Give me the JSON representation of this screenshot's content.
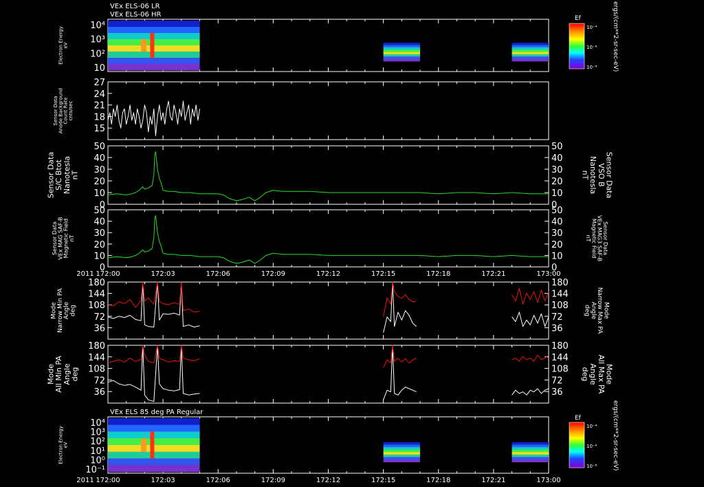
{
  "colors": {
    "green": "#22dd22",
    "red": "#ee1111",
    "white": "#ffffff"
  },
  "header": {
    "line1": "VEx ELS-06 LR",
    "line2": "VEx ELS-06 HR",
    "panel7_title": "VEx ELS 85 deg PA Regular"
  },
  "colorbar": {
    "title": "Ef",
    "unit": "ergs/(cm**2-sr-sec-eV)",
    "top_ticks": [
      "10⁻⁴",
      "10⁻⁶",
      "10⁻⁸"
    ],
    "bottom_ticks": [
      "10⁻⁴",
      "10⁻⁶",
      "10⁻⁸"
    ]
  },
  "time_axis": {
    "year": "2011",
    "ticks": [
      "172:00",
      "172:03",
      "172:06",
      "172:09",
      "172:12",
      "172:15",
      "172:18",
      "172:21",
      "173:00"
    ]
  },
  "chart_data": [
    {
      "type": "heatmap",
      "id": "p1",
      "ylabel": [
        "Electron Energy",
        "eV"
      ],
      "yticks": [
        "10⁴",
        "10³",
        "10²",
        "10"
      ],
      "segments": [
        {
          "start": "172:00",
          "end": "172:05"
        },
        {
          "start": "172:15",
          "end": "172:17"
        },
        {
          "start": "172:22",
          "end": "172:24"
        }
      ]
    },
    {
      "type": "line",
      "id": "p2",
      "ylabel": [
        "Sensor Data",
        "Anode Background",
        "Count Rate",
        "cnts/sec"
      ],
      "ylim": [
        12,
        27
      ],
      "yticks": [
        "27",
        "24",
        "21",
        "18",
        "15"
      ],
      "series": [
        {
          "color": "white",
          "x": [
            0,
            0.1,
            0.2,
            0.3,
            0.4,
            0.5,
            0.6,
            0.7,
            0.8,
            0.9,
            1.0,
            1.1,
            1.2,
            1.3,
            1.4,
            1.5,
            1.6,
            1.7,
            1.8,
            1.9,
            2.0,
            2.1,
            2.2,
            2.3,
            2.4,
            2.5,
            2.6,
            2.7,
            2.8,
            2.9,
            3.0,
            3.1,
            3.2,
            3.3,
            3.4,
            3.5,
            3.6,
            3.7,
            3.8,
            3.9,
            4.0,
            4.1,
            4.2,
            4.3,
            4.4,
            4.5,
            4.6,
            4.7,
            4.8,
            4.9,
            5.0
          ],
          "y": [
            17,
            19,
            16,
            20,
            18,
            21,
            17,
            15,
            19,
            20,
            16,
            18,
            21,
            17,
            19,
            16,
            20,
            18,
            15,
            17,
            21,
            19,
            14,
            18,
            16,
            20,
            13,
            18,
            21,
            17,
            19,
            16,
            20,
            22,
            18,
            17,
            21,
            19,
            16,
            20,
            18,
            22,
            17,
            19,
            21,
            16,
            20,
            18,
            21,
            17,
            20
          ]
        }
      ]
    },
    {
      "type": "line",
      "id": "p3",
      "ylabel": [
        "Sensor Data",
        "S/C Btot",
        "Nanotesla",
        "nT"
      ],
      "ylabel_right": [
        "Sensor Data",
        "VSO B",
        "Nanotesla",
        "nT"
      ],
      "ylim": [
        0,
        50
      ],
      "yticks": [
        "50",
        "40",
        "30",
        "20",
        "10",
        "0"
      ],
      "series": [
        {
          "color": "green",
          "x": [
            0,
            0.5,
            1.0,
            1.3,
            1.5,
            1.7,
            1.9,
            2.0,
            2.2,
            2.4,
            2.5,
            2.55,
            2.6,
            2.7,
            2.8,
            2.9,
            3.0,
            3.3,
            3.6,
            4.0,
            4.5,
            5.0,
            5.5,
            6.0,
            6.3,
            6.6,
            7.0,
            7.3,
            7.7,
            8.0,
            8.3,
            8.6,
            9.0,
            9.5,
            10,
            11,
            12,
            13,
            14,
            15,
            16,
            17,
            18,
            19,
            20,
            21,
            22,
            23,
            24
          ],
          "y": [
            8,
            9,
            8,
            9,
            10,
            12,
            15,
            13,
            14,
            16,
            25,
            42,
            45,
            30,
            22,
            18,
            12,
            11,
            11,
            10,
            10,
            9,
            9,
            9,
            8,
            5,
            3,
            4,
            6,
            3,
            6,
            10,
            12,
            11,
            11,
            11,
            10,
            10,
            10,
            10,
            10,
            10,
            9,
            10,
            10,
            9,
            10,
            9,
            9
          ]
        }
      ]
    },
    {
      "type": "line",
      "id": "p4",
      "ylabel": [
        "Sensor Data",
        "VEx MAG SAF-B",
        "Magnetic Field",
        "nT"
      ],
      "ylabel_right": [
        "Sensor Data",
        "VEx MAG3 SAF-B",
        "Magnetic Field",
        "nT"
      ],
      "ylim": [
        0,
        50
      ],
      "yticks": [
        "50",
        "40",
        "30",
        "20",
        "10",
        "0"
      ],
      "series": [
        {
          "color": "green",
          "x": [
            0,
            0.5,
            1.0,
            1.3,
            1.5,
            1.7,
            1.9,
            2.0,
            2.2,
            2.4,
            2.5,
            2.55,
            2.6,
            2.7,
            2.8,
            2.9,
            3.0,
            3.3,
            3.6,
            4.0,
            4.5,
            5.0,
            5.5,
            6.0,
            6.3,
            6.6,
            7.0,
            7.3,
            7.7,
            8.0,
            8.3,
            8.6,
            9.0,
            9.5,
            10,
            11,
            12,
            13,
            14,
            15,
            16,
            17,
            18,
            19,
            20,
            21,
            22,
            23,
            24
          ],
          "y": [
            8,
            9,
            8,
            9,
            10,
            12,
            15,
            13,
            14,
            16,
            25,
            42,
            45,
            30,
            22,
            18,
            12,
            11,
            11,
            10,
            10,
            9,
            9,
            9,
            8,
            5,
            3,
            4,
            6,
            3,
            6,
            10,
            12,
            11,
            11,
            11,
            10,
            10,
            10,
            10,
            10,
            10,
            9,
            10,
            10,
            9,
            10,
            9,
            9
          ]
        }
      ]
    },
    {
      "type": "line",
      "id": "p5",
      "ylabel": [
        "Mode",
        "Narrow Min PA",
        "Angle",
        "deg"
      ],
      "ylabel_right": [
        "Mode",
        "Narrow Max PA",
        "Angle",
        "deg"
      ],
      "ylim": [
        0,
        180
      ],
      "yticks": [
        "180",
        "144",
        "108",
        "72",
        "36"
      ],
      "series": [
        {
          "color": "white",
          "x": [
            0,
            0.3,
            0.6,
            0.9,
            1.2,
            1.5,
            1.8,
            1.9,
            2.0,
            2.2,
            2.5,
            2.7,
            2.8,
            3.0,
            3.3,
            3.6,
            3.9,
            4.0,
            4.1,
            4.4,
            4.7,
            5.0,
            null,
            15.0,
            15.2,
            15.4,
            15.5,
            15.6,
            15.8,
            16.0,
            16.2,
            16.4,
            16.6,
            16.8,
            null,
            22.0,
            22.2,
            22.4,
            22.6,
            22.8,
            23.0,
            23.2,
            23.4,
            23.6,
            23.8,
            24.0
          ],
          "y": [
            70,
            65,
            72,
            68,
            75,
            62,
            58,
            180,
            45,
            40,
            38,
            180,
            60,
            80,
            78,
            82,
            76,
            180,
            40,
            45,
            38,
            42,
            null,
            20,
            70,
            55,
            180,
            40,
            85,
            60,
            90,
            75,
            50,
            40,
            null,
            70,
            55,
            85,
            40,
            60,
            45,
            75,
            50,
            80,
            40,
            70
          ]
        },
        {
          "color": "red",
          "x": [
            0,
            0.3,
            0.6,
            0.9,
            1.2,
            1.5,
            1.8,
            1.9,
            2.0,
            2.2,
            2.5,
            2.7,
            2.8,
            3.0,
            3.3,
            3.6,
            3.9,
            4.0,
            4.1,
            4.4,
            4.7,
            5.0,
            null,
            15.0,
            15.2,
            15.4,
            15.5,
            15.6,
            15.8,
            16.0,
            16.2,
            16.4,
            16.6,
            16.8,
            null,
            22.0,
            22.2,
            22.4,
            22.6,
            22.8,
            23.0,
            23.2,
            23.4,
            23.6,
            23.8,
            24.0
          ],
          "y": [
            110,
            105,
            118,
            112,
            125,
            100,
            122,
            180,
            120,
            130,
            110,
            180,
            118,
            112,
            108,
            115,
            110,
            180,
            90,
            95,
            85,
            88,
            null,
            70,
            130,
            110,
            180,
            150,
            135,
            128,
            140,
            125,
            118,
            120,
            null,
            140,
            120,
            160,
            110,
            145,
            125,
            150,
            115,
            155,
            120,
            150
          ]
        }
      ]
    },
    {
      "type": "line",
      "id": "p6",
      "ylabel": [
        "Mode",
        "All Min PA",
        "Angle",
        "deg"
      ],
      "ylabel_right": [
        "Mode",
        "All Max PA",
        "Angle",
        "deg"
      ],
      "ylim": [
        0,
        180
      ],
      "yticks": [
        "180",
        "144",
        "108",
        "72",
        "36"
      ],
      "series": [
        {
          "color": "white",
          "x": [
            0,
            0.3,
            0.6,
            0.9,
            1.2,
            1.5,
            1.8,
            1.9,
            2.0,
            2.2,
            2.5,
            2.7,
            2.8,
            3.0,
            3.3,
            3.6,
            3.9,
            4.0,
            4.1,
            4.4,
            4.7,
            5.0,
            null,
            15.0,
            15.2,
            15.4,
            15.5,
            15.6,
            15.8,
            16.0,
            16.2,
            16.4,
            16.6,
            16.8,
            null,
            22.0,
            22.2,
            22.4,
            22.6,
            22.8,
            23.0,
            23.2,
            23.4,
            23.6,
            23.8,
            24.0
          ],
          "y": [
            65,
            70,
            60,
            55,
            58,
            50,
            40,
            180,
            25,
            10,
            5,
            180,
            60,
            45,
            40,
            38,
            42,
            180,
            30,
            25,
            28,
            30,
            null,
            10,
            40,
            35,
            180,
            30,
            25,
            40,
            50,
            45,
            40,
            35,
            null,
            25,
            40,
            30,
            35,
            25,
            40,
            35,
            45,
            30,
            40,
            45
          ]
        },
        {
          "color": "red",
          "x": [
            0,
            0.3,
            0.6,
            0.9,
            1.2,
            1.5,
            1.8,
            1.9,
            2.0,
            2.2,
            2.5,
            2.7,
            2.8,
            3.0,
            3.3,
            3.6,
            3.9,
            4.0,
            4.1,
            4.4,
            4.7,
            5.0,
            null,
            15.0,
            15.2,
            15.4,
            15.5,
            15.6,
            15.8,
            16.0,
            16.2,
            16.4,
            16.6,
            16.8,
            null,
            22.0,
            22.2,
            22.4,
            22.6,
            22.8,
            23.0,
            23.2,
            23.4,
            23.6,
            23.8,
            24.0
          ],
          "y": [
            125,
            130,
            135,
            128,
            140,
            130,
            135,
            180,
            150,
            130,
            125,
            180,
            140,
            135,
            128,
            132,
            130,
            180,
            140,
            135,
            132,
            138,
            null,
            110,
            135,
            125,
            180,
            130,
            140,
            128,
            138,
            125,
            135,
            140,
            null,
            135,
            140,
            130,
            145,
            135,
            140,
            130,
            150,
            135,
            140,
            150
          ]
        }
      ]
    },
    {
      "type": "heatmap",
      "id": "p7",
      "ylabel": [
        "Electron Energy",
        "eV"
      ],
      "yticks": [
        "10⁴",
        "10³",
        "10²",
        "10¹",
        "10⁰",
        "10⁻¹"
      ],
      "segments": [
        {
          "start": "172:00",
          "end": "172:05"
        },
        {
          "start": "172:15",
          "end": "172:17"
        },
        {
          "start": "172:22",
          "end": "172:24"
        }
      ]
    }
  ]
}
